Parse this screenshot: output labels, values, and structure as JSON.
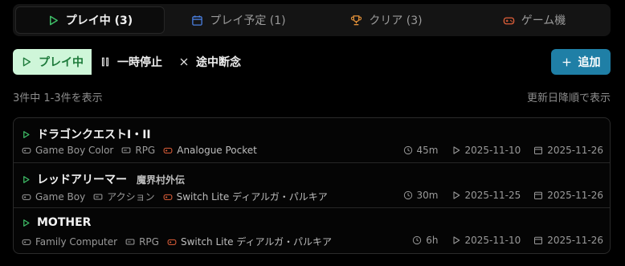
{
  "tabs": [
    {
      "label": "プレイ中 (3)",
      "icon": "play-icon",
      "color": "#3fbf68"
    },
    {
      "label": "プレイ予定 (1)",
      "icon": "calendar-icon",
      "color": "#4a7fe0"
    },
    {
      "label": "クリア (3)",
      "icon": "trophy-icon",
      "color": "#e8943a"
    },
    {
      "label": "ゲーム機",
      "icon": "gamepad-icon",
      "color": "#e2603a"
    }
  ],
  "filters": {
    "playing": "プレイ中",
    "paused": "一時停止",
    "abandoned": "途中断念"
  },
  "add_button": "追加",
  "count_text": "3件中 1-3件を表示",
  "sort_text": "更新日降順で表示",
  "rows": [
    {
      "title": "ドラゴンクエストI・II",
      "subtitle": "",
      "platform": "Game Boy Color",
      "genre": "RPG",
      "device": "Analogue Pocket",
      "time": "45m",
      "started": "2025-11-10",
      "updated": "2025-11-26"
    },
    {
      "title": "レッドアリーマー",
      "subtitle": "魔界村外伝",
      "platform": "Game Boy",
      "genre": "アクション",
      "device": "Switch Lite ディアルガ・パルキア",
      "time": "30m",
      "started": "2025-11-25",
      "updated": "2025-11-26"
    },
    {
      "title": "MOTHER",
      "subtitle": "",
      "platform": "Family Computer",
      "genre": "RPG",
      "device": "Switch Lite ディアルガ・パルキア",
      "time": "6h",
      "started": "2025-11-10",
      "updated": "2025-11-26"
    }
  ]
}
